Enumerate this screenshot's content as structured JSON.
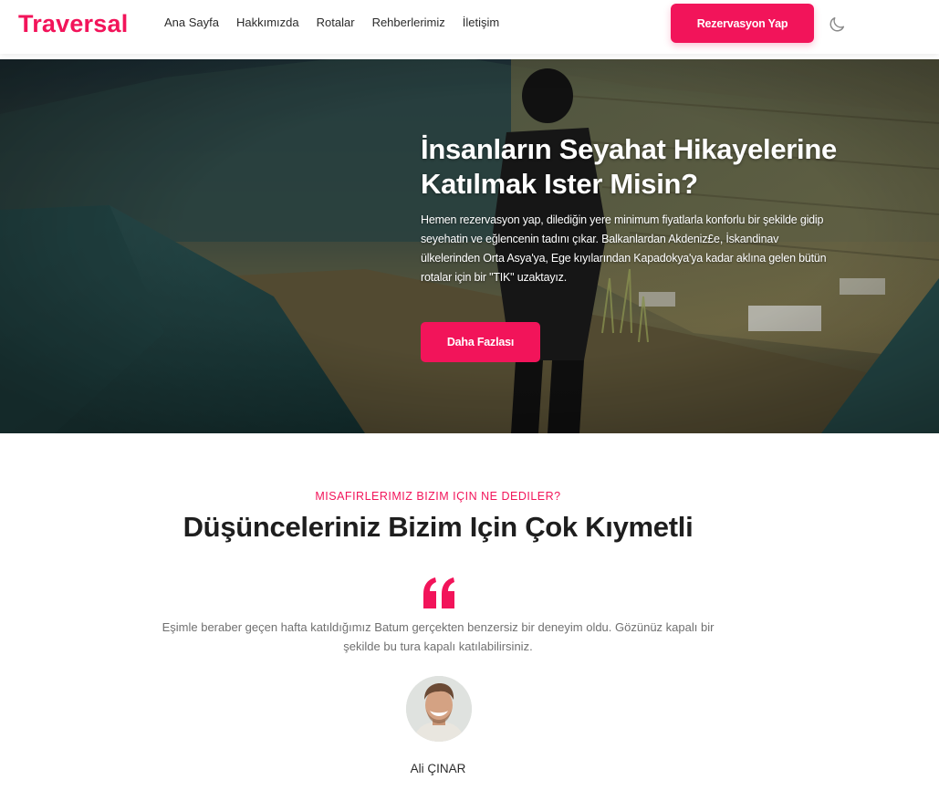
{
  "header": {
    "logo": "Traversal",
    "nav": [
      "Ana Sayfa",
      "Hakkımızda",
      "Rotalar",
      "Rehberlerimiz",
      "İletişim"
    ],
    "cta_label": "Rezervasyon Yap",
    "theme_icon": "moon-icon"
  },
  "hero": {
    "title": "İnsanların Seyahat Hikayelerine Katılmak Ister Misin?",
    "text": "Hemen rezervasyon yap, dilediğin yere minimum fiyatlarla konforlu bir şekilde gidip seyehatin ve eğlencenin tadını çıkar. Balkanlardan Akdeniz£e, İskandinav ülkelerinden Orta Asya'ya, Ege kıyılarından Kapadokya'ya kadar aklına gelen bütün rotalar için bir \"TIK\" uzaktayız.",
    "button_label": "Daha Fazlası"
  },
  "testimonials": {
    "eyebrow": "MISAFIRLERIMIZ BIZIM IÇIN NE DEDILER?",
    "title": "Düşünceleriniz Bizim Için Çok Kıymetli",
    "quote_icon": "quote-icon",
    "quote": "Eşimle beraber geçen hafta katıldığımız Batum gerçekten benzersiz bir deneyim oldu. Gözünüz kapalı bir şekilde bu tura kapalı katılabilirsiniz.",
    "author": "Ali ÇINAR"
  },
  "colors": {
    "accent": "#f2145a",
    "text_dark": "#1e1e1e",
    "text_muted": "#707070"
  }
}
